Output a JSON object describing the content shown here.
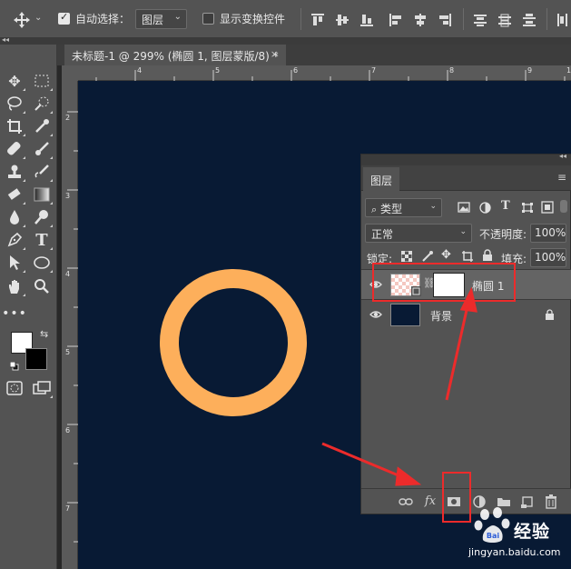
{
  "options_bar": {
    "auto_select_label": "自动选择：",
    "auto_select_target": "图层",
    "show_transform_label": "显示变换控件"
  },
  "document": {
    "tab_title": "未标题-1 @ 299% (椭圆 1, 图层蒙版/8) *",
    "close_glyph": "×",
    "canvas_color": "#081a34",
    "ring_color": "#fdaf5b"
  },
  "rulers": {
    "h_ticks": [
      "4",
      "5",
      "6",
      "7",
      "8",
      "9",
      "1"
    ],
    "v_ticks": [
      "2",
      "3",
      "4",
      "5",
      "6",
      "7"
    ]
  },
  "layers_panel": {
    "tab_label": "图层",
    "filter_kind": "类型",
    "blend_mode": "正常",
    "opacity_label": "不透明度:",
    "opacity_value": "100%",
    "lock_label": "锁定:",
    "fill_label": "填充:",
    "fill_value": "100%",
    "layers": [
      {
        "name": "椭圆 1",
        "visible": true,
        "selected": true,
        "has_mask": true
      },
      {
        "name": "背景",
        "visible": true,
        "locked": true
      }
    ],
    "bottom_icons": [
      "link-icon",
      "fx-icon",
      "add-mask-icon",
      "adjustment-icon",
      "group-folder-icon",
      "new-layer-icon",
      "trash-icon"
    ],
    "fx_label": "fx"
  },
  "watermark": {
    "brand": "经验",
    "url": "jingyan.baidu.com",
    "logo_mark": "Bai"
  },
  "colors": {
    "annotation_red": "#ec2b2b",
    "ui_panel": "#535353",
    "foreground": "#ffffff",
    "background": "#000000"
  }
}
